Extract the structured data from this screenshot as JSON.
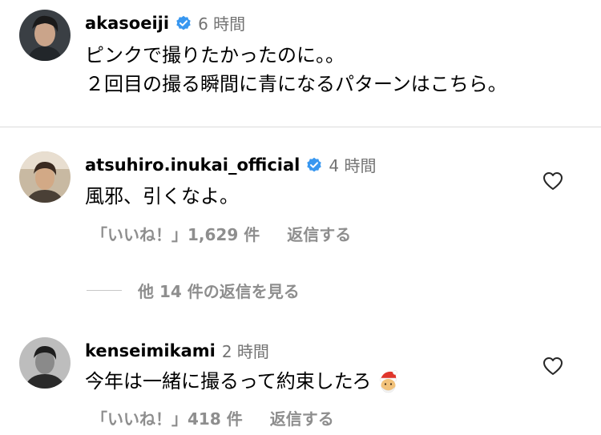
{
  "caption": {
    "username": "akasoeiji",
    "time": "6 時間",
    "lines": [
      "ピンクで撮りたかったのに。。",
      "２回目の撮る瞬間に青になるパターンはこちら。"
    ]
  },
  "comments": [
    {
      "username": "atsuhiro.inukai_official",
      "time": "4 時間",
      "text": "風邪、引くなよ。",
      "likes_label": "「いいね！」1,629 件",
      "reply_label": "返信する",
      "verified": true
    },
    {
      "username": "kenseimikami",
      "time": "2 時間",
      "text": "今年は一緒に撮るって約束したろ",
      "likes_label": "「いいね！」418 件",
      "reply_label": "返信する",
      "verified": false,
      "emoji": "santa-face"
    }
  ],
  "view_replies": "他 14 件の返信を見る",
  "colors": {
    "verified": "#3897f0",
    "secondary": "#8e8e8e",
    "time": "#737373",
    "divider": "#dbdbdb"
  }
}
